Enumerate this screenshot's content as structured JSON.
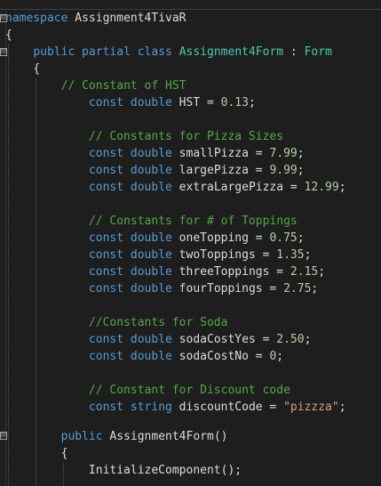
{
  "editor": {
    "lines": [
      [
        "namespace",
        " Assignment4TivaR"
      ],
      [
        "{"
      ],
      [
        "    ",
        "public",
        " ",
        "partial",
        " ",
        "class",
        " ",
        "Assignment4Form",
        " : ",
        "Form"
      ],
      [
        "    {"
      ],
      [
        "        ",
        "// Constant of HST"
      ],
      [
        "            ",
        "const",
        " ",
        "double",
        " HST = ",
        "0.13",
        ";"
      ],
      [
        ""
      ],
      [
        "            ",
        "// Constants for Pizza Sizes"
      ],
      [
        "            ",
        "const",
        " ",
        "double",
        " smallPizza = ",
        "7.99",
        ";"
      ],
      [
        "            ",
        "const",
        " ",
        "double",
        " largePizza = ",
        "9.99",
        ";"
      ],
      [
        "            ",
        "const",
        " ",
        "double",
        " extraLargePizza = ",
        "12.99",
        ";"
      ],
      [
        ""
      ],
      [
        "            ",
        "// Constants for # of Toppings"
      ],
      [
        "            ",
        "const",
        " ",
        "double",
        " oneTopping = ",
        "0.75",
        ";"
      ],
      [
        "            ",
        "const",
        " ",
        "double",
        " twoToppings = ",
        "1.35",
        ";"
      ],
      [
        "            ",
        "const",
        " ",
        "double",
        " threeToppings = ",
        "2.15",
        ";"
      ],
      [
        "            ",
        "const",
        " ",
        "double",
        " fourToppings = ",
        "2.75",
        ";"
      ],
      [
        ""
      ],
      [
        "            ",
        "//Constants for Soda"
      ],
      [
        "            ",
        "const",
        " ",
        "double",
        " sodaCostYes = ",
        "2.50",
        ";"
      ],
      [
        "            ",
        "const",
        " ",
        "double",
        " sodaCostNo = ",
        "0",
        ";"
      ],
      [
        ""
      ],
      [
        "            ",
        "// Constant for Discount code"
      ],
      [
        "            ",
        "const",
        " ",
        "string",
        " discountCode = ",
        "\"pizzza\"",
        ";"
      ],
      [
        ""
      ],
      [
        "        ",
        "public",
        " Assignment4Form()"
      ],
      [
        "        {"
      ],
      [
        "            InitializeComponent();"
      ]
    ],
    "fold_markers": [
      "⊟",
      "⊟",
      "⊟"
    ]
  }
}
